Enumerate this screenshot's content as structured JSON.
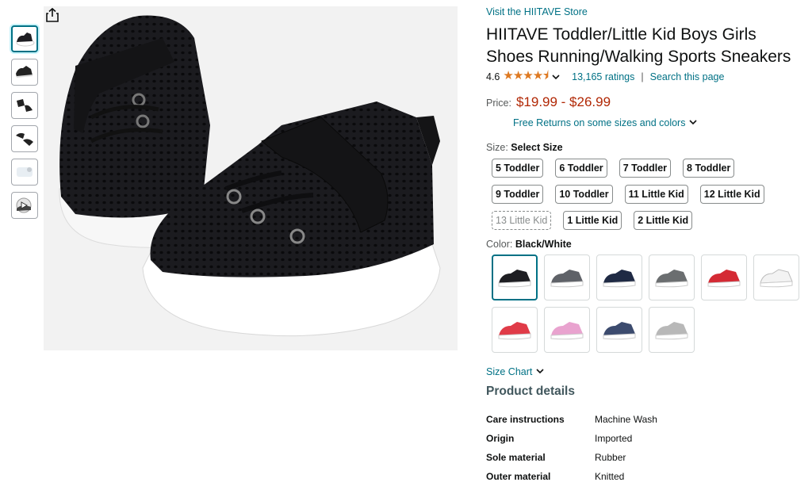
{
  "store_link": "Visit the HIITAVE Store",
  "title": "HIITAVE Toddler/Little Kid Boys Girls Shoes Running/Walking Sports Sneakers",
  "rating": {
    "value": "4.6",
    "stars": "★★★★⯨",
    "ratings_text": "13,165 ratings",
    "separator": "|",
    "search_text": "Search this page"
  },
  "price": {
    "label": "Price:",
    "value": "$19.99 - $26.99",
    "returns": "Free Returns on some sizes and colors"
  },
  "size": {
    "label": "Size:",
    "selected": "Select Size",
    "options": [
      "5 Toddler",
      "6 Toddler",
      "7 Toddler",
      "8 Toddler",
      "9 Toddler",
      "10 Toddler",
      "11 Little Kid",
      "12 Little Kid",
      "13 Little Kid",
      "1 Little Kid",
      "2 Little Kid"
    ]
  },
  "color": {
    "label": "Color:",
    "selected": "Black/White",
    "swatch_colors": [
      "#1e1e22",
      "#5f6268",
      "#1f2a44",
      "#6b6e70",
      "#d42a34",
      "#f3f3f3",
      "#e03b48",
      "#e9a3cf",
      "#3c4b6e",
      "#b8b8b8"
    ]
  },
  "size_chart": "Size Chart",
  "product_details": {
    "title": "Product details",
    "rows": [
      {
        "key": "Care instructions",
        "value": "Machine Wash"
      },
      {
        "key": "Origin",
        "value": "Imported"
      },
      {
        "key": "Sole material",
        "value": "Rubber"
      },
      {
        "key": "Outer material",
        "value": "Knitted"
      }
    ]
  },
  "icons": {
    "share": "share-icon",
    "chevron": "chevron-down-icon"
  }
}
